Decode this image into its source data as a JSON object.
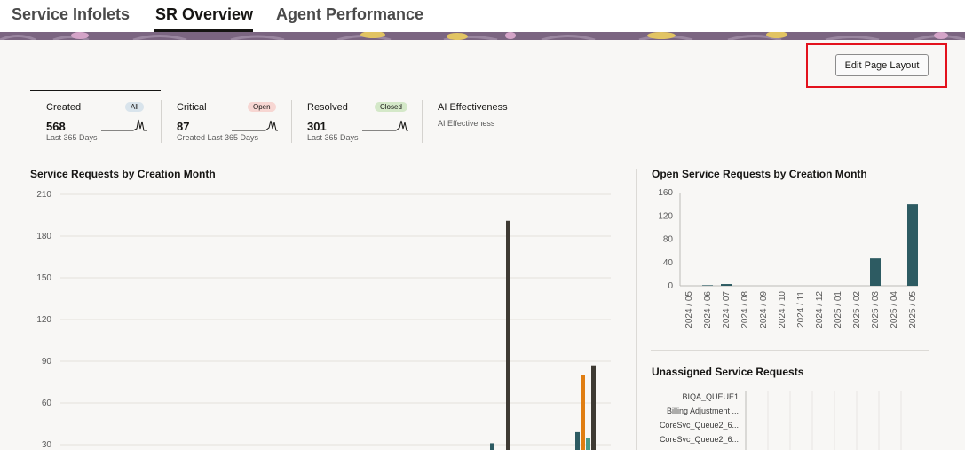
{
  "tabs": [
    {
      "label": "Service Infolets",
      "active": false
    },
    {
      "label": "SR Overview",
      "active": true
    },
    {
      "label": "Agent Performance",
      "active": false
    }
  ],
  "toolbar": {
    "edit_layout_label": "Edit Page Layout"
  },
  "infolets": [
    {
      "title": "Created",
      "badge": "All",
      "badge_color": "#d9e4ec",
      "value": "568",
      "subtitle": "Last 365 Days"
    },
    {
      "title": "Critical",
      "badge": "Open",
      "badge_color": "#f7d6d2",
      "value": "87",
      "subtitle": "Created Last 365 Days"
    },
    {
      "title": "Resolved",
      "badge": "Closed",
      "badge_color": "#d4e8c8",
      "value": "301",
      "subtitle": "Last 365 Days"
    },
    {
      "title": "AI Effectiveness",
      "subtitle": "AI Effectiveness"
    }
  ],
  "charts": {
    "by_month_title": "Service Requests by Creation Month",
    "open_by_month_title": "Open Service Requests by Creation Month",
    "unassigned_title": "Unassigned Service Requests"
  },
  "chart_data": [
    {
      "type": "bar",
      "title": "Service Requests by Creation Month",
      "y_ticks": [
        210,
        180,
        150,
        120,
        90,
        60,
        30
      ],
      "ylim": [
        0,
        210
      ],
      "grid": true,
      "series": [
        {
          "color": "#2d5b62",
          "values": [
            31,
            39
          ]
        },
        {
          "color": "#3e3a33",
          "values": [
            191,
            87
          ]
        },
        {
          "color": "#e07e12",
          "values": [
            80
          ]
        },
        {
          "color": "#4a9a8a",
          "values": [
            35
          ]
        }
      ]
    },
    {
      "type": "bar",
      "title": "Open Service Requests by Creation Month",
      "categories": [
        "2024 / 05",
        "2024 / 06",
        "2024 / 07",
        "2024 / 08",
        "2024 / 09",
        "2024 / 10",
        "2024 / 11",
        "2024 / 12",
        "2025 / 01",
        "2025 / 02",
        "2025 / 03",
        "2025 / 04",
        "2025 / 05"
      ],
      "values": [
        0,
        1,
        3,
        0,
        0,
        0,
        0,
        0,
        0,
        0,
        47,
        0,
        140
      ],
      "y_ticks": [
        160,
        120,
        80,
        40,
        0
      ],
      "ylim": [
        0,
        160
      ],
      "bar_color": "#2d5b62"
    },
    {
      "type": "bar",
      "title": "Unassigned Service Requests",
      "categories": [
        "BIQA_QUEUE1",
        "Billing Adjustment ...",
        "CoreSvc_Queue2_6...",
        "CoreSvc_Queue2_6..."
      ]
    }
  ],
  "colors": {
    "accent": "#161513",
    "banner": "#7b6581",
    "highlight": "#e3121d"
  }
}
